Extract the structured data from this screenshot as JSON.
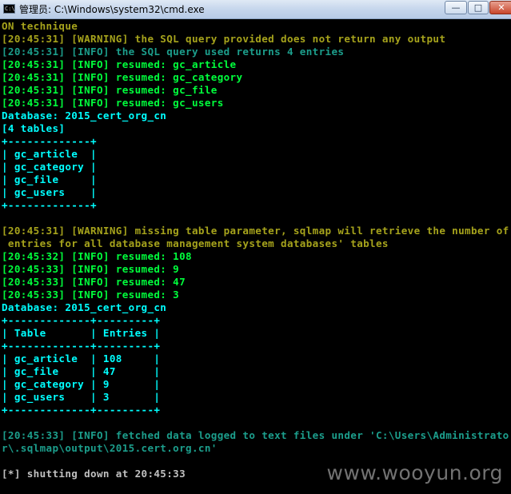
{
  "window": {
    "title": "管理员: C:\\Windows\\system32\\cmd.exe",
    "icon_label": "C:\\",
    "minimize_label": "—",
    "maximize_label": "□",
    "close_label": "✕"
  },
  "colors": {
    "warning": "#a6a31c",
    "info": "#00ff3c",
    "cyan": "#00ffff",
    "fetched": "#1c9e8c",
    "text": "#c0c0c0"
  },
  "console": {
    "lines": [
      {
        "text": "ON technique",
        "color": "yellow"
      },
      {
        "text": "[20:45:31] [WARNING] the SQL query provided does not return any output",
        "color": "yellow"
      },
      {
        "text": "[20:45:31] [INFO] the SQL query used returns 4 entries",
        "color": "dgreen"
      },
      {
        "text": "[20:45:31] [INFO] resumed: gc_article",
        "color": "green"
      },
      {
        "text": "[20:45:31] [INFO] resumed: gc_category",
        "color": "green"
      },
      {
        "text": "[20:45:31] [INFO] resumed: gc_file",
        "color": "green"
      },
      {
        "text": "[20:45:31] [INFO] resumed: gc_users",
        "color": "green"
      },
      {
        "text": "Database: 2015_cert_org_cn",
        "color": "cyan"
      },
      {
        "text": "[4 tables]",
        "color": "cyan"
      },
      {
        "text": "+-------------+",
        "color": "cyan"
      },
      {
        "text": "| gc_article  |",
        "color": "cyan"
      },
      {
        "text": "| gc_category |",
        "color": "cyan"
      },
      {
        "text": "| gc_file     |",
        "color": "cyan"
      },
      {
        "text": "| gc_users    |",
        "color": "cyan"
      },
      {
        "text": "+-------------+",
        "color": "cyan"
      },
      {
        "text": "",
        "color": "gray"
      },
      {
        "text": "[20:45:31] [WARNING] missing table parameter, sqlmap will retrieve the number of",
        "color": "yellow"
      },
      {
        "text": " entries for all database management system databases' tables",
        "color": "yellow"
      },
      {
        "text": "[20:45:32] [INFO] resumed: 108",
        "color": "green"
      },
      {
        "text": "[20:45:33] [INFO] resumed: 9",
        "color": "green"
      },
      {
        "text": "[20:45:33] [INFO] resumed: 47",
        "color": "green"
      },
      {
        "text": "[20:45:33] [INFO] resumed: 3",
        "color": "green"
      },
      {
        "text": "Database: 2015_cert_org_cn",
        "color": "cyan"
      },
      {
        "text": "+-------------+---------+",
        "color": "cyan"
      },
      {
        "text": "| Table       | Entries |",
        "color": "cyan"
      },
      {
        "text": "+-------------+---------+",
        "color": "cyan"
      },
      {
        "text": "| gc_article  | 108     |",
        "color": "cyan"
      },
      {
        "text": "| gc_file     | 47      |",
        "color": "cyan"
      },
      {
        "text": "| gc_category | 9       |",
        "color": "cyan"
      },
      {
        "text": "| gc_users    | 3       |",
        "color": "cyan"
      },
      {
        "text": "+-------------+---------+",
        "color": "cyan"
      },
      {
        "text": "",
        "color": "gray"
      },
      {
        "text": "[20:45:33] [INFO] fetched data logged to text files under 'C:\\Users\\Administrato",
        "color": "dgreen"
      },
      {
        "text": "r\\.sqlmap\\output\\2015.cert.org.cn'",
        "color": "dgreen"
      },
      {
        "text": "",
        "color": "gray"
      },
      {
        "text": "[*] shutting down at 20:45:33",
        "color": "gray"
      }
    ]
  },
  "watermark": "www.wooyun.org"
}
